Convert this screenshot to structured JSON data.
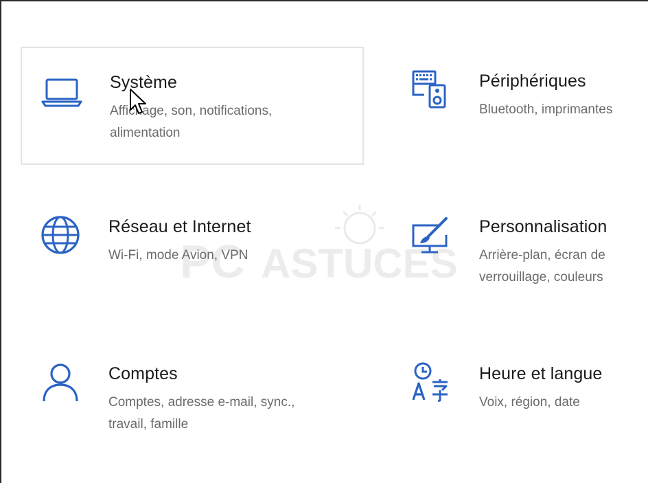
{
  "settings": {
    "accent_color": "#2b63c4",
    "tiles": [
      {
        "title": "Système",
        "desc_line1": "Affichage, son, notifications,",
        "desc_line2": "alimentation",
        "icon": "laptop-icon",
        "state": "hovered"
      },
      {
        "title": "Périphériques",
        "desc_line1": "Bluetooth, imprimantes",
        "desc_line2": "",
        "icon": "devices-icon"
      },
      {
        "title": "Réseau et Internet",
        "desc_line1": "Wi-Fi, mode Avion, VPN",
        "desc_line2": "",
        "icon": "globe-icon"
      },
      {
        "title": "Personnalisation",
        "desc_line1": "Arrière-plan, écran de",
        "desc_line2": "verrouillage, couleurs",
        "icon": "personalization-icon"
      },
      {
        "title": "Comptes",
        "desc_line1": "Comptes, adresse e-mail, sync.,",
        "desc_line2": "travail, famille",
        "icon": "person-icon"
      },
      {
        "title": "Heure et langue",
        "desc_line1": "Voix, région, date",
        "desc_line2": "",
        "icon": "time-language-icon"
      }
    ]
  },
  "watermark": {
    "text_left": "PC",
    "text_right": "ASTUCES"
  }
}
